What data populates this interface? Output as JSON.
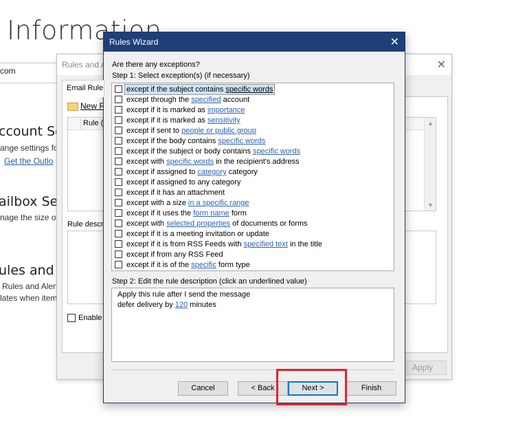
{
  "background": {
    "page_title": "Information",
    "account_text": "com",
    "account_settings_heading": "ccount Sett",
    "account_settings_text": "ange settings fo",
    "account_settings_link": "Get the Outlo",
    "mailbox_heading": "ailbox Sett",
    "mailbox_text": "nage the size of",
    "rules_heading": "ules and Al",
    "rules_text1": "Rules and Alert",
    "rules_text2": "lates when item"
  },
  "rules_alerts": {
    "title": "Rules and A",
    "tab_label": "Email Rule",
    "new_rule_label": "New R",
    "column_rule": "Rule (a",
    "desc_label": "Rule descr",
    "enable_label": "Enable",
    "apply_label": "Apply"
  },
  "wizard": {
    "title": "Rules Wizard",
    "question": "Are there any exceptions?",
    "step1_label": "Step 1: Select exception(s) (if necessary)",
    "exceptions": [
      {
        "pre": "except if the subject contains ",
        "link": "specific words",
        "post": ""
      },
      {
        "pre": "except through the ",
        "link": "specified",
        "post": " account"
      },
      {
        "pre": "except if it is marked as ",
        "link": "importance",
        "post": ""
      },
      {
        "pre": "except if it is marked as ",
        "link": "sensitivity",
        "post": ""
      },
      {
        "pre": "except if sent to ",
        "link": "people or public group",
        "post": ""
      },
      {
        "pre": "except if the body contains ",
        "link": "specific words",
        "post": ""
      },
      {
        "pre": "except if the subject or body contains ",
        "link": "specific words",
        "post": ""
      },
      {
        "pre": "except with ",
        "link": "specific words",
        "post": " in the recipient's address"
      },
      {
        "pre": "except if assigned to ",
        "link": "category",
        "post": " category"
      },
      {
        "pre": "except if assigned to any category",
        "link": "",
        "post": ""
      },
      {
        "pre": "except if it has an attachment",
        "link": "",
        "post": ""
      },
      {
        "pre": "except with a size ",
        "link": "in a specific range",
        "post": ""
      },
      {
        "pre": "except if it uses the ",
        "link": "form name",
        "post": " form"
      },
      {
        "pre": "except with ",
        "link": "selected properties",
        "post": " of documents or forms"
      },
      {
        "pre": "except if it is a meeting invitation or update",
        "link": "",
        "post": ""
      },
      {
        "pre": "except if it is from RSS Feeds with ",
        "link": "specified text",
        "post": " in the title"
      },
      {
        "pre": "except if from any RSS Feed",
        "link": "",
        "post": ""
      },
      {
        "pre": "except if it is of the ",
        "link": "specific",
        "post": " form type"
      }
    ],
    "step2_label": "Step 2: Edit the rule description (click an underlined value)",
    "description_line1": "Apply this rule after I send the message",
    "description_line2_pre": "defer delivery by ",
    "description_line2_link": "120",
    "description_line2_post": " minutes",
    "buttons": {
      "cancel": "Cancel",
      "back": "< Back",
      "next": "Next >",
      "finish": "Finish"
    },
    "highlight_color": "#e3222c"
  }
}
